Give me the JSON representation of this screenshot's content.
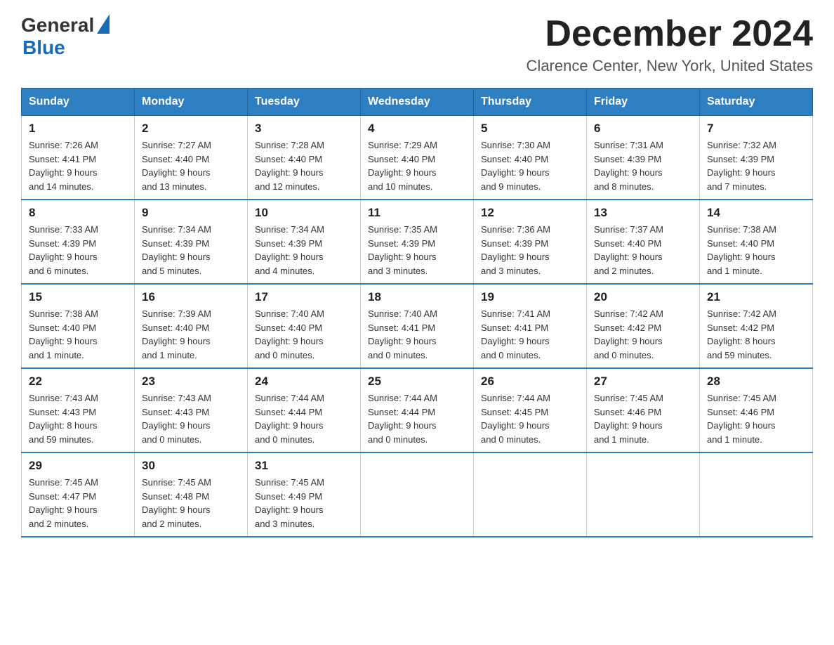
{
  "header": {
    "logo_general": "General",
    "logo_blue": "Blue",
    "month": "December 2024",
    "location": "Clarence Center, New York, United States"
  },
  "days_of_week": [
    "Sunday",
    "Monday",
    "Tuesday",
    "Wednesday",
    "Thursday",
    "Friday",
    "Saturday"
  ],
  "weeks": [
    [
      {
        "day": "1",
        "info": "Sunrise: 7:26 AM\nSunset: 4:41 PM\nDaylight: 9 hours\nand 14 minutes."
      },
      {
        "day": "2",
        "info": "Sunrise: 7:27 AM\nSunset: 4:40 PM\nDaylight: 9 hours\nand 13 minutes."
      },
      {
        "day": "3",
        "info": "Sunrise: 7:28 AM\nSunset: 4:40 PM\nDaylight: 9 hours\nand 12 minutes."
      },
      {
        "day": "4",
        "info": "Sunrise: 7:29 AM\nSunset: 4:40 PM\nDaylight: 9 hours\nand 10 minutes."
      },
      {
        "day": "5",
        "info": "Sunrise: 7:30 AM\nSunset: 4:40 PM\nDaylight: 9 hours\nand 9 minutes."
      },
      {
        "day": "6",
        "info": "Sunrise: 7:31 AM\nSunset: 4:39 PM\nDaylight: 9 hours\nand 8 minutes."
      },
      {
        "day": "7",
        "info": "Sunrise: 7:32 AM\nSunset: 4:39 PM\nDaylight: 9 hours\nand 7 minutes."
      }
    ],
    [
      {
        "day": "8",
        "info": "Sunrise: 7:33 AM\nSunset: 4:39 PM\nDaylight: 9 hours\nand 6 minutes."
      },
      {
        "day": "9",
        "info": "Sunrise: 7:34 AM\nSunset: 4:39 PM\nDaylight: 9 hours\nand 5 minutes."
      },
      {
        "day": "10",
        "info": "Sunrise: 7:34 AM\nSunset: 4:39 PM\nDaylight: 9 hours\nand 4 minutes."
      },
      {
        "day": "11",
        "info": "Sunrise: 7:35 AM\nSunset: 4:39 PM\nDaylight: 9 hours\nand 3 minutes."
      },
      {
        "day": "12",
        "info": "Sunrise: 7:36 AM\nSunset: 4:39 PM\nDaylight: 9 hours\nand 3 minutes."
      },
      {
        "day": "13",
        "info": "Sunrise: 7:37 AM\nSunset: 4:40 PM\nDaylight: 9 hours\nand 2 minutes."
      },
      {
        "day": "14",
        "info": "Sunrise: 7:38 AM\nSunset: 4:40 PM\nDaylight: 9 hours\nand 1 minute."
      }
    ],
    [
      {
        "day": "15",
        "info": "Sunrise: 7:38 AM\nSunset: 4:40 PM\nDaylight: 9 hours\nand 1 minute."
      },
      {
        "day": "16",
        "info": "Sunrise: 7:39 AM\nSunset: 4:40 PM\nDaylight: 9 hours\nand 1 minute."
      },
      {
        "day": "17",
        "info": "Sunrise: 7:40 AM\nSunset: 4:40 PM\nDaylight: 9 hours\nand 0 minutes."
      },
      {
        "day": "18",
        "info": "Sunrise: 7:40 AM\nSunset: 4:41 PM\nDaylight: 9 hours\nand 0 minutes."
      },
      {
        "day": "19",
        "info": "Sunrise: 7:41 AM\nSunset: 4:41 PM\nDaylight: 9 hours\nand 0 minutes."
      },
      {
        "day": "20",
        "info": "Sunrise: 7:42 AM\nSunset: 4:42 PM\nDaylight: 9 hours\nand 0 minutes."
      },
      {
        "day": "21",
        "info": "Sunrise: 7:42 AM\nSunset: 4:42 PM\nDaylight: 8 hours\nand 59 minutes."
      }
    ],
    [
      {
        "day": "22",
        "info": "Sunrise: 7:43 AM\nSunset: 4:43 PM\nDaylight: 8 hours\nand 59 minutes."
      },
      {
        "day": "23",
        "info": "Sunrise: 7:43 AM\nSunset: 4:43 PM\nDaylight: 9 hours\nand 0 minutes."
      },
      {
        "day": "24",
        "info": "Sunrise: 7:44 AM\nSunset: 4:44 PM\nDaylight: 9 hours\nand 0 minutes."
      },
      {
        "day": "25",
        "info": "Sunrise: 7:44 AM\nSunset: 4:44 PM\nDaylight: 9 hours\nand 0 minutes."
      },
      {
        "day": "26",
        "info": "Sunrise: 7:44 AM\nSunset: 4:45 PM\nDaylight: 9 hours\nand 0 minutes."
      },
      {
        "day": "27",
        "info": "Sunrise: 7:45 AM\nSunset: 4:46 PM\nDaylight: 9 hours\nand 1 minute."
      },
      {
        "day": "28",
        "info": "Sunrise: 7:45 AM\nSunset: 4:46 PM\nDaylight: 9 hours\nand 1 minute."
      }
    ],
    [
      {
        "day": "29",
        "info": "Sunrise: 7:45 AM\nSunset: 4:47 PM\nDaylight: 9 hours\nand 2 minutes."
      },
      {
        "day": "30",
        "info": "Sunrise: 7:45 AM\nSunset: 4:48 PM\nDaylight: 9 hours\nand 2 minutes."
      },
      {
        "day": "31",
        "info": "Sunrise: 7:45 AM\nSunset: 4:49 PM\nDaylight: 9 hours\nand 3 minutes."
      },
      {
        "day": "",
        "info": ""
      },
      {
        "day": "",
        "info": ""
      },
      {
        "day": "",
        "info": ""
      },
      {
        "day": "",
        "info": ""
      }
    ]
  ]
}
